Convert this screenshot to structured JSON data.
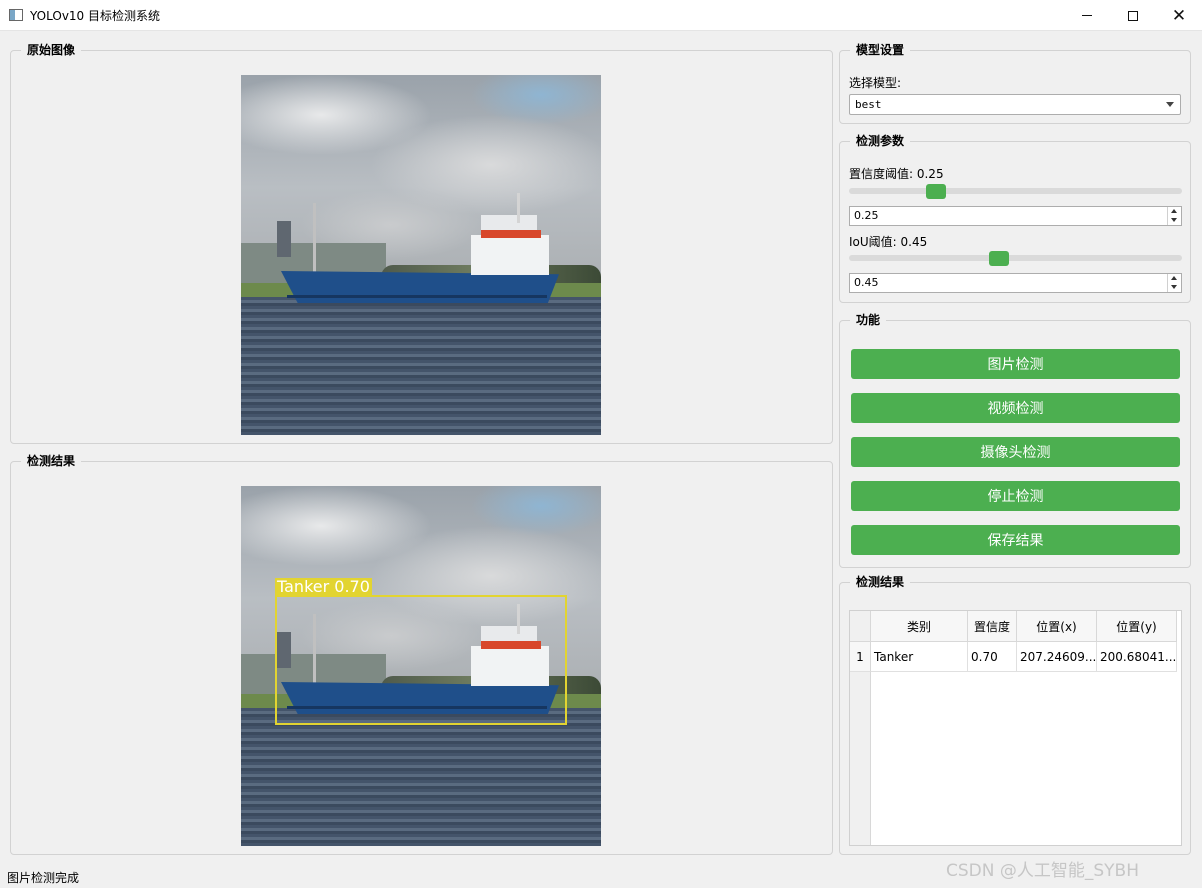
{
  "window": {
    "title": "YOLOv10 目标检测系统"
  },
  "original_panel": {
    "title": "原始图像"
  },
  "result_panel": {
    "title": "检测结果",
    "detection_label": "Tanker 0.70"
  },
  "model_settings": {
    "title": "模型设置",
    "select_label": "选择模型:",
    "selected_model": "best"
  },
  "detection_params": {
    "title": "检测参数",
    "confidence_label": "置信度阈值: 0.25",
    "confidence_value": "0.25",
    "confidence_fraction": 0.25,
    "iou_label": "IoU阈值: 0.45",
    "iou_value": "0.45",
    "iou_fraction": 0.45
  },
  "functions": {
    "title": "功能",
    "buttons": [
      "图片检测",
      "视频检测",
      "摄像头检测",
      "停止检测",
      "保存结果"
    ]
  },
  "results_table": {
    "title": "检测结果",
    "headers": [
      "类别",
      "置信度",
      "位置(x)",
      "位置(y)"
    ],
    "rows": [
      {
        "num": "1",
        "cells": [
          "Tanker",
          "0.70",
          "207.24609...",
          "200.68041..."
        ]
      }
    ]
  },
  "status": "图片检测完成",
  "watermark": "CSDN @人工智能_SYBH",
  "colors": {
    "accent": "#4caf50",
    "bbox": "#e2d431"
  }
}
